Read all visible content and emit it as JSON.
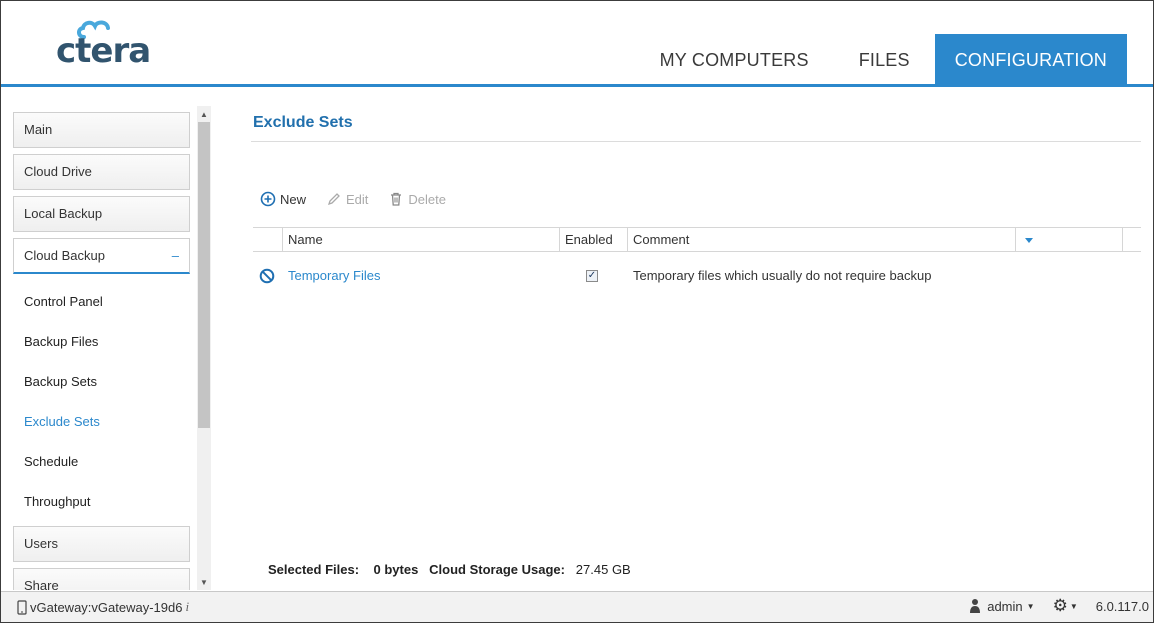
{
  "header": {
    "logo_text": "ctera",
    "tabs": [
      {
        "label": "MY COMPUTERS"
      },
      {
        "label": "FILES"
      },
      {
        "label": "CONFIGURATION"
      }
    ],
    "active_tab_color": "#2b88cc"
  },
  "sidebar": {
    "items": [
      {
        "label": "Main"
      },
      {
        "label": "Cloud Drive"
      },
      {
        "label": "Local Backup"
      },
      {
        "label": "Cloud Backup",
        "toggle": "–"
      },
      {
        "label": "Users"
      },
      {
        "label": "Share"
      }
    ],
    "subitems": [
      {
        "label": "Control Panel"
      },
      {
        "label": "Backup Files"
      },
      {
        "label": "Backup Sets"
      },
      {
        "label": "Exclude Sets"
      },
      {
        "label": "Schedule"
      },
      {
        "label": "Throughput"
      }
    ]
  },
  "main": {
    "title": "Exclude Sets",
    "toolbar": {
      "new_label": "New",
      "edit_label": "Edit",
      "delete_label": "Delete"
    },
    "columns": {
      "name": "Name",
      "enabled": "Enabled",
      "comment": "Comment"
    },
    "rows": [
      {
        "name": "Temporary Files",
        "enabled": true,
        "comment": "Temporary files which usually do not require backup"
      }
    ],
    "footer": {
      "selected_files_label": "Selected Files:",
      "selected_files_value": "0 bytes",
      "cloud_usage_label": "Cloud Storage Usage:",
      "cloud_usage_value": "27.45 GB"
    }
  },
  "statusbar": {
    "device": "vGateway:vGateway-19d6",
    "user": "admin",
    "version": "6.0.117.0"
  },
  "colors": {
    "accent": "#2b88cc",
    "title": "#2170ad",
    "logo": "#31546e"
  }
}
